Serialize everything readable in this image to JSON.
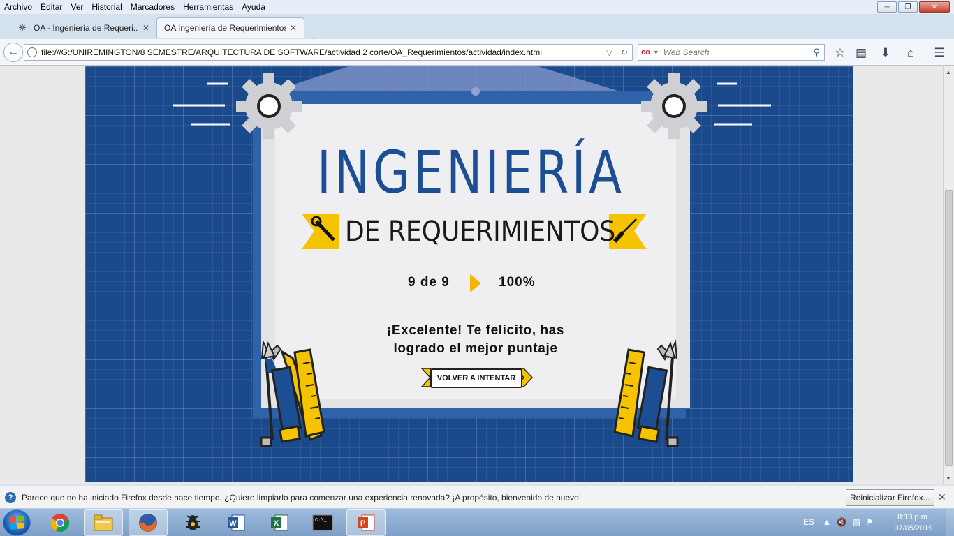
{
  "menu": [
    "Archivo",
    "Editar",
    "Ver",
    "Historial",
    "Marcadores",
    "Herramientas",
    "Ayuda"
  ],
  "tabs": [
    {
      "title": "OA - Ingeniería de Requeri..."
    },
    {
      "title": "OA Ingeniería de Requerimientos"
    }
  ],
  "address": {
    "url": "file:///G:/UNIREMINGTON/8 SEMESTRE/ARQUITECTURA DE SOFTWARE/actividad 2 corte/OA_Requerimientos/actividad/index.html"
  },
  "search": {
    "placeholder": "Web Search"
  },
  "page": {
    "title": "INGENIERÍA",
    "subtitle": "DE REQUERIMIENTOS",
    "score_count": "9 de 9",
    "score_percent": "100%",
    "progress": 1.0,
    "message": "¡Excelente! Te felicito, has logrado el mejor puntaje",
    "retry_label": "VOLVER A INTENTAR",
    "colors": {
      "background": "#1a4a8c",
      "title": "#1c4e93",
      "accent": "#f5c300"
    }
  },
  "notification": {
    "text": "Parece que no ha iniciado Firefox desde hace tiempo. ¿Quiere limpiarlo para comenzar una experiencia renovada? ¡A propósito, bienvenido de nuevo!",
    "button": "Reinicializar Firefox..."
  },
  "taskbar": {
    "apps": [
      "chrome-icon",
      "file-explorer-icon",
      "firefox-icon",
      "bug-icon",
      "word-icon",
      "excel-icon",
      "terminal-icon",
      "powerpoint-icon"
    ],
    "language": "ES",
    "time": "8:13 p.m.",
    "date": "07/05/2019"
  }
}
